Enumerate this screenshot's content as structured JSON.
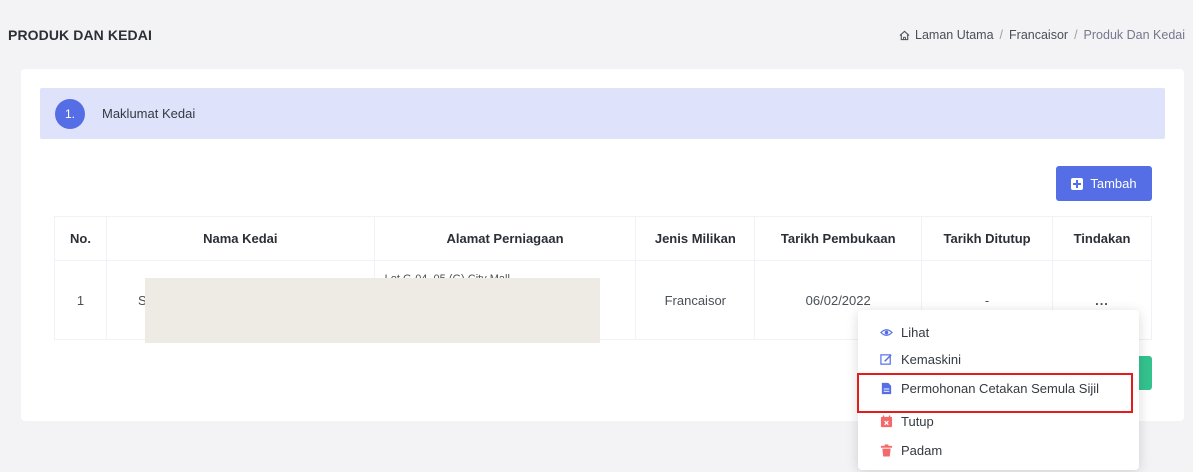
{
  "header": {
    "title": "PRODUK DAN KEDAI",
    "breadcrumb": [
      "Laman Utama",
      "Francaisor",
      "Produk Dan Kedai"
    ]
  },
  "step": {
    "number": "1.",
    "label": "Maklumat Kedai"
  },
  "add_button": {
    "label": "Tambah"
  },
  "table": {
    "columns": [
      "No.",
      "Nama Kedai",
      "Alamat Perniagaan",
      "Jenis Milikan",
      "Tarikh Pembukaan",
      "Tarikh Ditutup",
      "Tindakan"
    ],
    "rows": [
      {
        "no": "1",
        "name": "S",
        "address": "Lot G-04, 05 (G) City Mall",
        "ownership": "Francaisor",
        "opened": "06/02/2022",
        "closed": "-",
        "action": "..."
      }
    ]
  },
  "dropdown": {
    "items": [
      {
        "label": "Lihat",
        "icon": "eye-icon",
        "color": "#556ee6"
      },
      {
        "label": "Kemaskini",
        "icon": "edit-icon",
        "color": "#556ee6"
      },
      {
        "label": "Permohonan Cetakan Semula Sijil",
        "icon": "document-icon",
        "color": "#556ee6"
      },
      {
        "label": "Tutup",
        "icon": "calendar-x-icon",
        "color": "#f46a6a"
      },
      {
        "label": "Padam",
        "icon": "trash-icon",
        "color": "#f46a6a"
      }
    ]
  },
  "colors": {
    "primary": "#556ee6",
    "danger": "#f46a6a",
    "success": "#34c38f",
    "highlight": "#e41c1c"
  }
}
